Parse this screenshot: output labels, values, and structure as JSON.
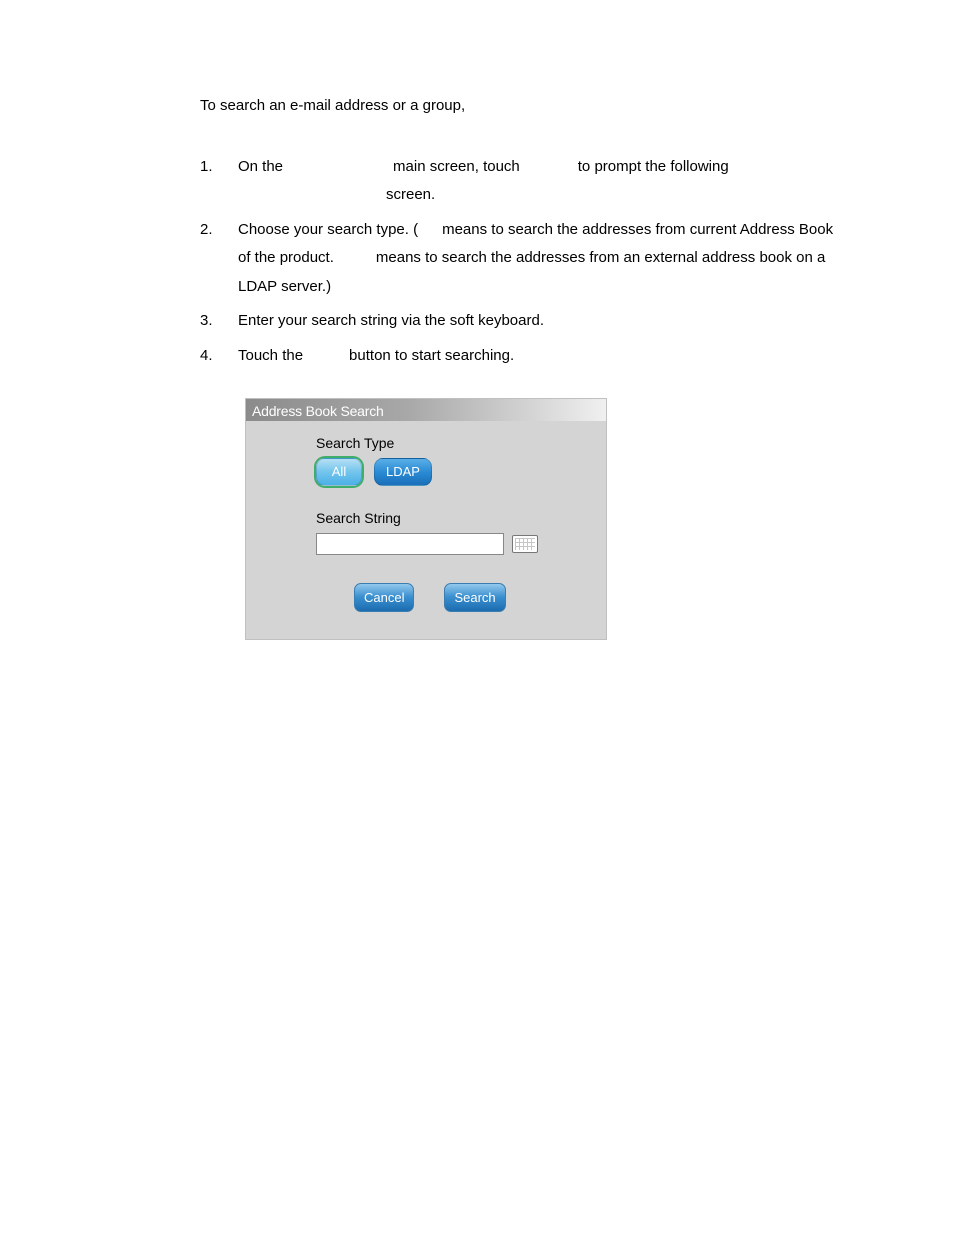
{
  "intro": "To search an e-mail address or a group,",
  "steps": [
    {
      "num": "1.",
      "part1": "On the",
      "part2": "main screen, touch",
      "part3": "to prompt the following",
      "part4": "screen."
    },
    {
      "num": "2.",
      "part1": "Choose your search type.  (",
      "part2": "means to search the addresses from current Address Book of the product.",
      "part3": "means to search the addresses from an external address book on a LDAP server.)"
    },
    {
      "num": "3.",
      "part1": "Enter your search string via the soft keyboard."
    },
    {
      "num": "4.",
      "part1": "Touch the",
      "part2": "button to start searching."
    }
  ],
  "dialog": {
    "title": "Address Book Search",
    "search_type_label": "Search Type",
    "option_all": "All",
    "option_ldap": "LDAP",
    "search_string_label": "Search String",
    "search_string_value": "",
    "cancel_label": "Cancel",
    "search_label": "Search"
  }
}
